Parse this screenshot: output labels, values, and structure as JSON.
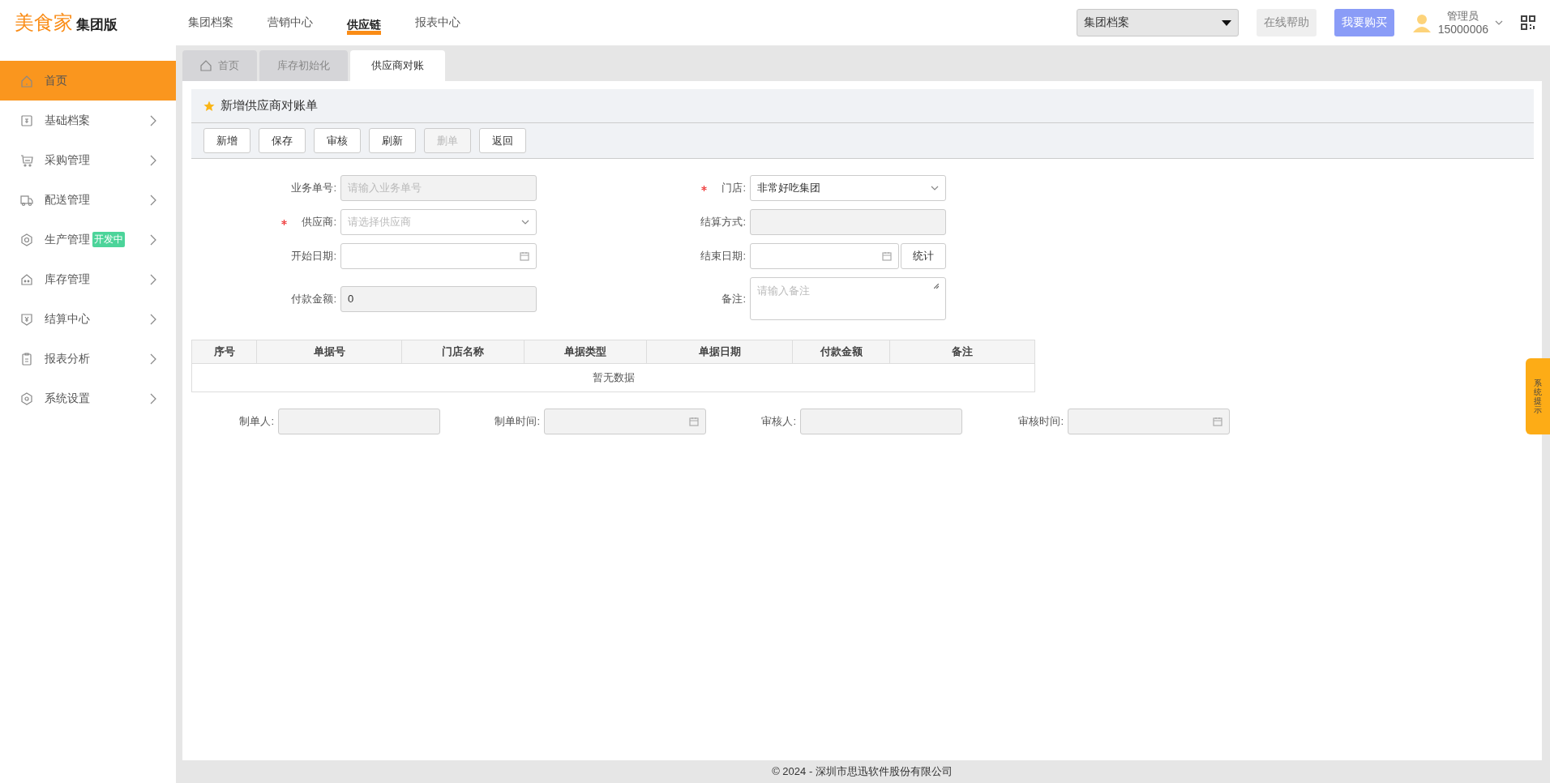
{
  "header": {
    "logo": {
      "brand": "美食家",
      "edition": "集团版"
    },
    "nav": [
      {
        "label": "集团档案",
        "selected": false
      },
      {
        "label": "营销中心",
        "selected": false
      },
      {
        "label": "供应链",
        "selected": true
      },
      {
        "label": "报表中心",
        "selected": false
      }
    ],
    "org_select": {
      "value": "集团档案"
    },
    "help_button": "在线帮助",
    "buy_button": "我要购买",
    "user": {
      "role": "管理员",
      "account": "15000006"
    }
  },
  "sidebar": {
    "items": [
      {
        "label": "首页",
        "selected": true,
        "expandable": false
      },
      {
        "label": "基础档案",
        "selected": false,
        "expandable": true
      },
      {
        "label": "采购管理",
        "selected": false,
        "expandable": true
      },
      {
        "label": "配送管理",
        "selected": false,
        "expandable": true
      },
      {
        "label": "生产管理",
        "badge": "开发中",
        "selected": false,
        "expandable": true
      },
      {
        "label": "库存管理",
        "selected": false,
        "expandable": true
      },
      {
        "label": "结算中心",
        "selected": false,
        "expandable": true
      },
      {
        "label": "报表分析",
        "selected": false,
        "expandable": true
      },
      {
        "label": "系统设置",
        "selected": false,
        "expandable": true
      }
    ]
  },
  "tabs": [
    {
      "label": "首页",
      "kind": "home",
      "selected": false
    },
    {
      "label": "库存初始化",
      "kind": "plain",
      "selected": false
    },
    {
      "label": "供应商对账",
      "kind": "plain",
      "selected": true
    }
  ],
  "panel": {
    "title": "新增供应商对账单",
    "toolbar": [
      {
        "label": "新增",
        "disabled": false
      },
      {
        "label": "保存",
        "disabled": false
      },
      {
        "label": "审核",
        "disabled": false
      },
      {
        "label": "刷新",
        "disabled": false
      },
      {
        "label": "删单",
        "disabled": true
      },
      {
        "label": "返回",
        "disabled": false
      }
    ],
    "form": {
      "fields": [
        {
          "label": "业务单号:",
          "kind": "text",
          "required": false,
          "disabled": true,
          "placeholder": "请输入业务单号"
        },
        {
          "label": "门店:",
          "kind": "select",
          "required": true,
          "disabled": false,
          "value": "非常好吃集团"
        },
        {
          "label": "供应商:",
          "kind": "select",
          "required": true,
          "disabled": false,
          "placeholder": "请选择供应商"
        },
        {
          "label": "结算方式:",
          "kind": "text",
          "required": false,
          "disabled": true
        },
        {
          "label": "开始日期:",
          "kind": "date",
          "required": false,
          "disabled": false
        },
        {
          "label": "结束日期:",
          "kind": "date",
          "required": false,
          "disabled": false,
          "action": "统计"
        },
        {
          "label": "付款金额:",
          "kind": "text",
          "required": false,
          "disabled": true,
          "value": "0"
        },
        {
          "label": "备注:",
          "kind": "textarea",
          "required": false,
          "disabled": false,
          "placeholder": "请输入备注"
        }
      ]
    },
    "table": {
      "columns": [
        "序号",
        "单据号",
        "门店名称",
        "单据类型",
        "单据日期",
        "付款金额",
        "备注"
      ],
      "empty_text": "暂无数据"
    },
    "audit_fields": [
      {
        "label": "制单人:",
        "kind": "text",
        "disabled": true
      },
      {
        "label": "制单时间:",
        "kind": "date",
        "disabled": true
      },
      {
        "label": "审核人:",
        "kind": "text",
        "disabled": true
      },
      {
        "label": "审核时间:",
        "kind": "date",
        "disabled": true
      }
    ]
  },
  "side_tab": {
    "label": "系统提示"
  },
  "footer": {
    "text": "© 2024 - 深圳市思迅软件股份有限公司"
  }
}
